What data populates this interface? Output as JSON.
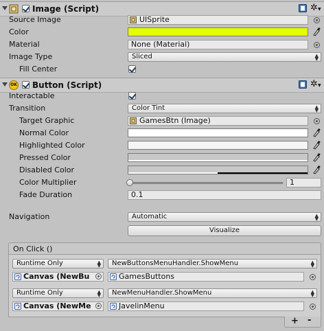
{
  "image_component": {
    "title": "Image (Script)",
    "enabled": true,
    "source_image": {
      "label": "Source Image",
      "value": "UISprite"
    },
    "color": {
      "label": "Color",
      "value": "#e4ff00"
    },
    "material": {
      "label": "Material",
      "value": "None (Material)"
    },
    "image_type": {
      "label": "Image Type",
      "value": "Sliced"
    },
    "fill_center": {
      "label": "Fill Center",
      "checked": true
    }
  },
  "button_component": {
    "title": "Button (Script)",
    "icon_text": "OK",
    "enabled": true,
    "interactable": {
      "label": "Interactable",
      "checked": true
    },
    "transition": {
      "label": "Transition",
      "value": "Color Tint"
    },
    "target_graphic": {
      "label": "Target Graphic",
      "value": "GamesBtn (Image)"
    },
    "normal_color": {
      "label": "Normal Color",
      "value": "#ffffff"
    },
    "highlighted_color": {
      "label": "Highlighted Color",
      "value": "#f5f5f5"
    },
    "pressed_color": {
      "label": "Pressed Color",
      "value": "#c8c8c8"
    },
    "disabled_color": {
      "label": "Disabled Color",
      "value": "#c8c8c8"
    },
    "color_multiplier": {
      "label": "Color Multiplier",
      "value": "1"
    },
    "fade_duration": {
      "label": "Fade Duration",
      "value": "0.1"
    },
    "navigation": {
      "label": "Navigation",
      "value": "Automatic"
    },
    "visualize_label": "Visualize"
  },
  "on_click": {
    "title": "On Click ()",
    "entries": [
      {
        "mode": "Runtime Only",
        "function": "NewButtonsMenuHandler.ShowMenu",
        "object": "Canvas (NewBu",
        "argument": "GamesButtons"
      },
      {
        "mode": "Runtime Only",
        "function": "NewMenuHandler.ShowMenu",
        "object": "Canvas (NewMe",
        "argument": "JavelinMenu"
      }
    ],
    "add_label": "+",
    "remove_label": "-"
  },
  "icons": [
    "foldout-arrow-icon",
    "image-component-icon",
    "button-component-icon",
    "help-book-icon",
    "gear-icon",
    "object-picker-icon",
    "eyedropper-icon",
    "script-icon",
    "sprite-icon"
  ]
}
